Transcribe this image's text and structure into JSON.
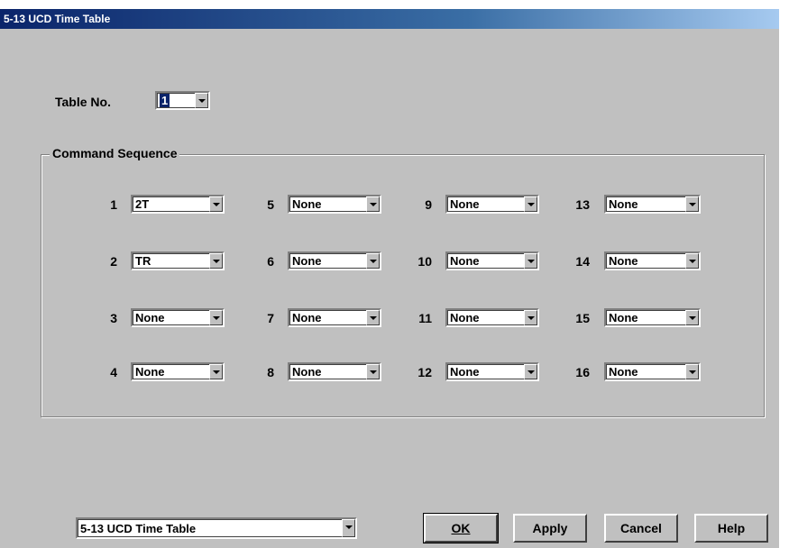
{
  "window": {
    "title": "5-13 UCD Time Table"
  },
  "table_no": {
    "label": "Table No.",
    "value": "1"
  },
  "command_sequence": {
    "label": "Command Sequence",
    "slots": [
      {
        "n": "1",
        "v": "2T"
      },
      {
        "n": "2",
        "v": "TR"
      },
      {
        "n": "3",
        "v": "None"
      },
      {
        "n": "4",
        "v": "None"
      },
      {
        "n": "5",
        "v": "None"
      },
      {
        "n": "6",
        "v": "None"
      },
      {
        "n": "7",
        "v": "None"
      },
      {
        "n": "8",
        "v": "None"
      },
      {
        "n": "9",
        "v": "None"
      },
      {
        "n": "10",
        "v": "None"
      },
      {
        "n": "11",
        "v": "None"
      },
      {
        "n": "12",
        "v": "None"
      },
      {
        "n": "13",
        "v": "None"
      },
      {
        "n": "14",
        "v": "None"
      },
      {
        "n": "15",
        "v": "None"
      },
      {
        "n": "16",
        "v": "None"
      }
    ]
  },
  "footer": {
    "screen_select": "5-13 UCD Time Table",
    "ok_label": "OK",
    "apply_label": "Apply",
    "cancel_label": "Cancel",
    "help_label": "Help"
  }
}
